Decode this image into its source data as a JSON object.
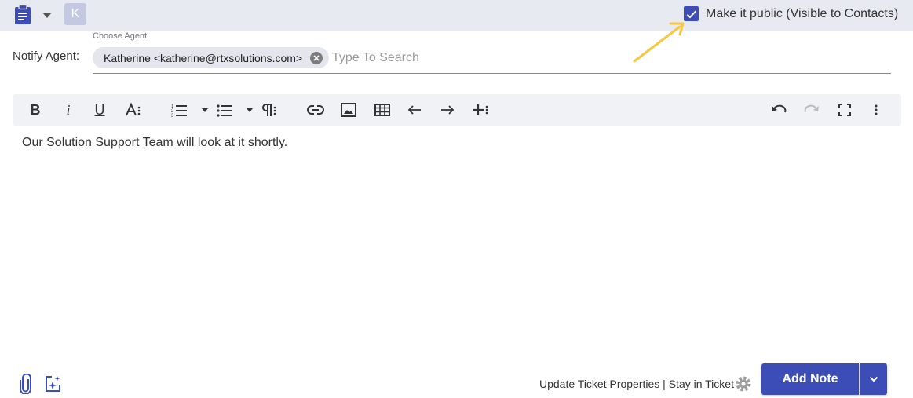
{
  "header": {
    "avatar_letter": "K",
    "public_checkbox": {
      "checked": true,
      "label": "Make it public (Visible to Contacts)"
    }
  },
  "notify": {
    "label": "Notify Agent:",
    "field_label": "Choose Agent",
    "selected_agent": "Katherine <katherine@rtxsolutions.com>",
    "placeholder": "Type To Search"
  },
  "toolbar": {
    "buttons": [
      "bold-icon",
      "italic-icon",
      "underline-icon",
      "font-size-icon",
      "ordered-list-icon",
      "unordered-list-icon",
      "paragraph-format-icon",
      "link-icon",
      "image-icon",
      "table-icon",
      "undo-arrow-icon",
      "redo-arrow-icon",
      "insert-more-icon",
      "undo-icon",
      "redo-icon",
      "fullscreen-icon",
      "more-options-icon"
    ],
    "bold": "B",
    "italic": "i",
    "underline": "U"
  },
  "editor": {
    "content": "Our Solution Support Team will look at it shortly."
  },
  "footer": {
    "link_text": "Update Ticket Properties | Stay in Ticket",
    "add_note_label": "Add Note"
  },
  "colors": {
    "accent": "#3d4db7",
    "top_bar": "#e8eaf2",
    "toolbar_bg": "#f1f2f5",
    "annotation_arrow": "#f5c842"
  }
}
